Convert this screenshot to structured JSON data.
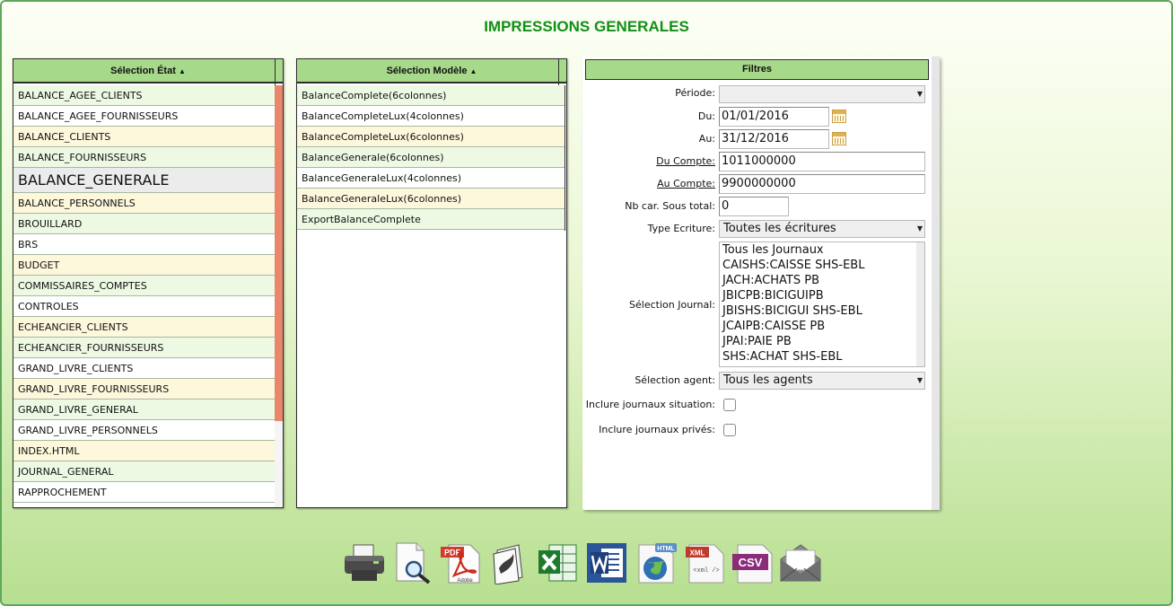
{
  "page_title": "IMPRESSIONS GENERALES",
  "etat_panel": {
    "header": "Sélection État",
    "items": [
      {
        "label": "BALANCE_AGEE_CLIENTS",
        "tone": "g"
      },
      {
        "label": "BALANCE_AGEE_FOURNISSEURS",
        "tone": "w"
      },
      {
        "label": "BALANCE_CLIENTS",
        "tone": "y"
      },
      {
        "label": "BALANCE_FOURNISSEURS",
        "tone": "g"
      },
      {
        "label": "BALANCE_GENERALE",
        "tone": "sel"
      },
      {
        "label": "BALANCE_PERSONNELS",
        "tone": "y"
      },
      {
        "label": "BROUILLARD",
        "tone": "g"
      },
      {
        "label": "BRS",
        "tone": "w"
      },
      {
        "label": "BUDGET",
        "tone": "y"
      },
      {
        "label": "COMMISSAIRES_COMPTES",
        "tone": "g"
      },
      {
        "label": "CONTROLES",
        "tone": "w"
      },
      {
        "label": "ECHEANCIER_CLIENTS",
        "tone": "y"
      },
      {
        "label": "ECHEANCIER_FOURNISSEURS",
        "tone": "g"
      },
      {
        "label": "GRAND_LIVRE_CLIENTS",
        "tone": "w"
      },
      {
        "label": "GRAND_LIVRE_FOURNISSEURS",
        "tone": "y"
      },
      {
        "label": "GRAND_LIVRE_GENERAL",
        "tone": "g"
      },
      {
        "label": "GRAND_LIVRE_PERSONNELS",
        "tone": "w"
      },
      {
        "label": "INDEX.HTML",
        "tone": "y"
      },
      {
        "label": "JOURNAL_GENERAL",
        "tone": "g"
      },
      {
        "label": "RAPPROCHEMENT",
        "tone": "w"
      }
    ]
  },
  "modele_panel": {
    "header": "Sélection Modèle",
    "items": [
      {
        "label": "BalanceComplete(6colonnes)",
        "tone": "g"
      },
      {
        "label": "BalanceCompleteLux(4colonnes)",
        "tone": "w"
      },
      {
        "label": "BalanceCompleteLux(6colonnes)",
        "tone": "y"
      },
      {
        "label": "BalanceGenerale(6colonnes)",
        "tone": "g"
      },
      {
        "label": "BalanceGeneraleLux(4colonnes)",
        "tone": "w"
      },
      {
        "label": "BalanceGeneraleLux(6colonnes)",
        "tone": "y"
      },
      {
        "label": "ExportBalanceComplete",
        "tone": "g"
      }
    ]
  },
  "filters": {
    "header": "Filtres",
    "periode_label": "Période:",
    "periode_value": "",
    "du_label": "Du:",
    "du_value": "01/01/2016",
    "au_label": "Au:",
    "au_value": "31/12/2016",
    "du_compte_label": "Du Compte:",
    "du_compte_value": "1011000000",
    "au_compte_label": "Au Compte:",
    "au_compte_value": "9900000000",
    "nb_car_label": "Nb car. Sous total:",
    "nb_car_value": "0",
    "type_ecriture_label": "Type Ecriture:",
    "type_ecriture_value": "Toutes les écritures",
    "journal_label": "Sélection Journal:",
    "journals": [
      "Tous les Journaux",
      "CAISHS:CAISSE SHS-EBL",
      "JACH:ACHATS PB",
      "JBICPB:BICIGUIPB",
      "JBISHS:BICIGUI SHS-EBL",
      "JCAIPB:CAISSE PB",
      "JPAI:PAIE PB",
      "SHS:ACHAT SHS-EBL"
    ],
    "agent_label": "Sélection agent:",
    "agent_value": "Tous les agents",
    "situation_label": "Inclure journaux situation:",
    "prives_label": "Inclure journaux privés:"
  },
  "toolbar": {
    "icons": [
      "printer-icon",
      "preview-icon",
      "pdf-icon",
      "draw-icon",
      "excel-icon",
      "word-icon",
      "html-icon",
      "xml-icon",
      "csv-icon",
      "email-icon"
    ],
    "pdf_text": "PDF",
    "adobe_text": "Adobe",
    "html_text": "HTML",
    "xml_text": "XML",
    "xml_tag_text": "<xml />",
    "csv_text": "CSV"
  },
  "colors": {
    "title": "#119016",
    "header_green": "#a6d98a",
    "scroll_thumb": "#e8876b"
  }
}
